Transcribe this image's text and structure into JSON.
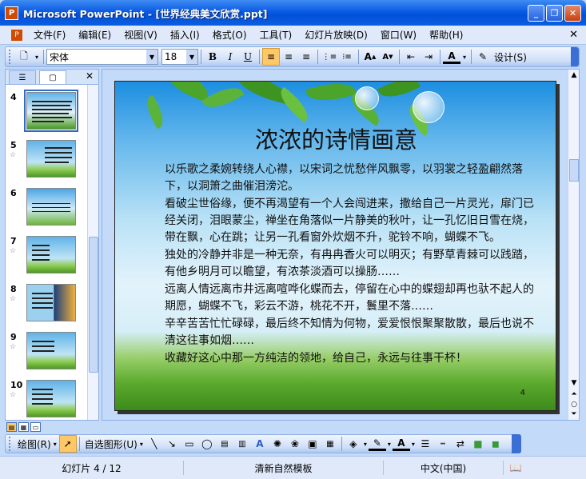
{
  "window": {
    "title": "Microsoft PowerPoint - [世界经典美文欣赏.ppt]",
    "app_icon": "powerpoint-icon"
  },
  "menu": {
    "items": [
      "文件(F)",
      "编辑(E)",
      "视图(V)",
      "插入(I)",
      "格式(O)",
      "工具(T)",
      "幻灯片放映(D)",
      "窗口(W)",
      "帮助(H)"
    ]
  },
  "toolbar": {
    "font_name": "宋体",
    "font_size": "18",
    "design_label": "设计(S)"
  },
  "thumbnails": [
    {
      "num": "4",
      "selected": true
    },
    {
      "num": "5",
      "selected": false
    },
    {
      "num": "6",
      "selected": false
    },
    {
      "num": "7",
      "selected": false
    },
    {
      "num": "8",
      "selected": false
    },
    {
      "num": "9",
      "selected": false
    },
    {
      "num": "10",
      "selected": false
    }
  ],
  "slide": {
    "title": "浓浓的诗情画意",
    "paragraphs": [
      "以乐歌之柔婉转绕人心襟，以宋词之忧愁伴风飘零，以羽裳之轻盈翩然落下，以洞箫之曲催泪滂沱。",
      "看破尘世俗缘，便不再渴望有一个人会闯进来，撒给自己一片灵光，扉门已经关闭，泪眼蒙尘，禅坐在角落似一片静美的秋叶，让一孔忆旧日雪在烧，带在飘，心在跳；让另一孔看窗外炊烟不升，驼铃不响，蝴蝶不飞。",
      "独处的冷静并非是一种无奈，有冉冉香火可以明灭；有野草青棘可以践踏，有他乡明月可以瞻望，有浓茶淡酒可以操肠……",
      "远离人情远离市井远离喧哗化蝶而去，停留在心中的蝶翅却再也驮不起人的期愿，蝴蝶不飞，彩云不游，桃花不开，鬟里不落……",
      "辛辛苦苦忙忙碌碌，最后终不知情为何物，爱爱恨恨聚聚散散，最后也说不清这往事如烟……",
      "收藏好这心中那一方纯洁的领地，给自己，永远与往事干杯！"
    ],
    "number": "4"
  },
  "drawing_toolbar": {
    "draw_label": "绘图(R)",
    "autoshape_label": "自选图形(U)"
  },
  "status": {
    "slide_info": "幻灯片 4 / 12",
    "template": "清新自然模板",
    "language": "中文(中国)"
  }
}
